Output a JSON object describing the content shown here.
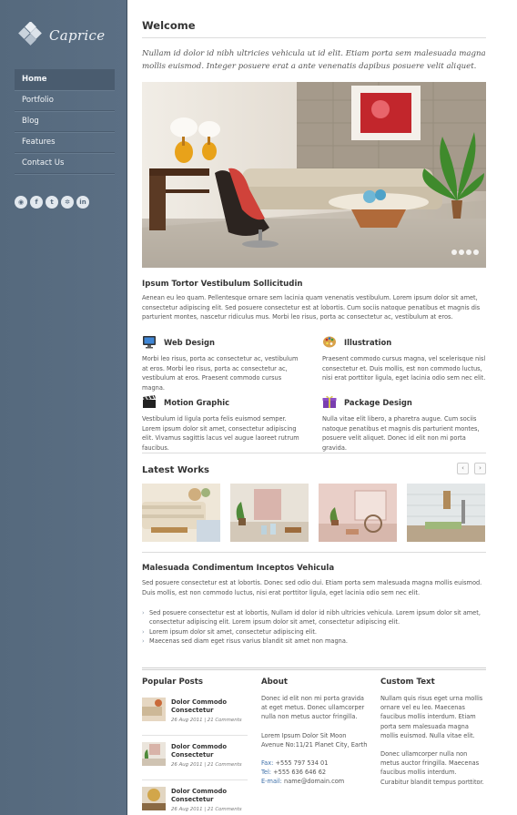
{
  "brand": {
    "name": "Caprice"
  },
  "nav": [
    {
      "label": "Home",
      "active": true
    },
    {
      "label": "Portfolio"
    },
    {
      "label": "Blog"
    },
    {
      "label": "Features"
    },
    {
      "label": "Contact Us"
    }
  ],
  "socials": [
    {
      "icon": "rss-icon",
      "glyph": "◉"
    },
    {
      "icon": "facebook-icon",
      "glyph": "f"
    },
    {
      "icon": "twitter-icon",
      "glyph": "t"
    },
    {
      "icon": "dribbble-icon",
      "glyph": "✲"
    },
    {
      "icon": "linkedin-icon",
      "glyph": "in"
    }
  ],
  "welcome": {
    "title": "Welcome",
    "intro": "Nullam id dolor id nibh ultricies vehicula ut id elit. Etiam porta sem malesuada magna mollis euismod. Integer posuere erat a ante venenatis dapibus posuere velit aliquet."
  },
  "slider": {
    "dots": 4
  },
  "section1": {
    "title": "Ipsum Tortor Vestibulum Sollicitudin",
    "text": "Aenean eu leo quam. Pellentesque ornare sem lacinia quam venenatis vestibulum. Lorem ipsum dolor sit amet, consectetur adipiscing elit. Sed posuere consectetur est at lobortis. Cum sociis natoque penatibus et magnis dis parturient montes, nascetur ridiculus mus. Morbi leo risus, porta ac consectetur ac, vestibulum at eros."
  },
  "features": [
    {
      "title": "Web Design",
      "icon": "monitor-icon",
      "text": "Morbi leo risus, porta ac consectetur ac, vestibulum at eros. Morbi leo risus, porta ac consectetur ac, vestibulum at eros. Praesent commodo cursus magna."
    },
    {
      "title": "Illustration",
      "icon": "palette-icon",
      "text": "Praesent commodo cursus magna, vel scelerisque nisl consectetur et. Duis mollis, est non commodo luctus, nisi erat porttitor ligula, eget lacinia odio sem nec elit."
    },
    {
      "title": "Motion Graphic",
      "icon": "clapperboard-icon",
      "text": "Vestibulum id ligula porta felis euismod semper. Lorem ipsum dolor sit amet, consectetur adipiscing elit. Vivamus sagittis lacus vel augue laoreet rutrum faucibus."
    },
    {
      "title": "Package Design",
      "icon": "gift-box-icon",
      "text": "Nulla vitae elit libero, a pharetra augue. Cum sociis natoque penatibus et magnis dis parturient montes, posuere velit aliquet. Donec id elit non mi porta gravida."
    }
  ],
  "latest_works": {
    "title": "Latest Works",
    "prev": "‹",
    "next": "›"
  },
  "section2": {
    "title": "Malesuada Condimentum Inceptos Vehicula",
    "text": "Sed posuere consectetur est at lobortis. Donec sed odio dui. Etiam porta sem malesuada magna mollis euismod. Duis mollis, est non commodo luctus, nisi erat porttitor ligula, eget lacinia odio sem nec elit.",
    "bullets": [
      "Sed posuere consectetur est at lobortis, Nullam id dolor id nibh ultricies vehicula. Lorem ipsum dolor sit amet, consectetur adipiscing elit. Lorem ipsum dolor sit amet, consectetur adipiscing elit.",
      "Lorem ipsum dolor sit amet, consectetur adipiscing elit.",
      "Maecenas sed diam eget risus varius blandit sit amet non magna."
    ]
  },
  "footer": {
    "popular": {
      "title": "Popular Posts",
      "posts": [
        {
          "title": "Dolor Commodo Consectetur",
          "meta": "26 Aug 2011 | 21 Comments"
        },
        {
          "title": "Dolor Commodo Consectetur",
          "meta": "26 Aug 2011 | 21 Comments"
        },
        {
          "title": "Dolor Commodo Consectetur",
          "meta": "26 Aug 2011 | 21 Comments"
        }
      ]
    },
    "about": {
      "title": "About",
      "text": "Donec id elit non mi porta gravida at eget metus. Donec ullamcorper nulla non metus auctor fringilla.",
      "address": "Lorem Ipsum Dolor Sit Moon Avenue No:11/21 Planet City, Earth",
      "fax_label": "Fax:",
      "fax": "+555 797 534 01",
      "tel_label": "Tel:",
      "tel": "+555 636 646 62",
      "email_label": "E-mail:",
      "email": "name@domain.com"
    },
    "custom": {
      "title": "Custom Text",
      "text1": "Nullam quis risus eget urna mollis ornare vel eu leo. Maecenas faucibus mollis interdum. Etiam porta sem malesuada magna mollis euismod. Nulla vitae elit.",
      "text2": "Donec ullamcorper nulla non metus auctor fringilla. Maecenas faucibus mollis interdum. Curabitur blandit tempus porttitor."
    }
  }
}
